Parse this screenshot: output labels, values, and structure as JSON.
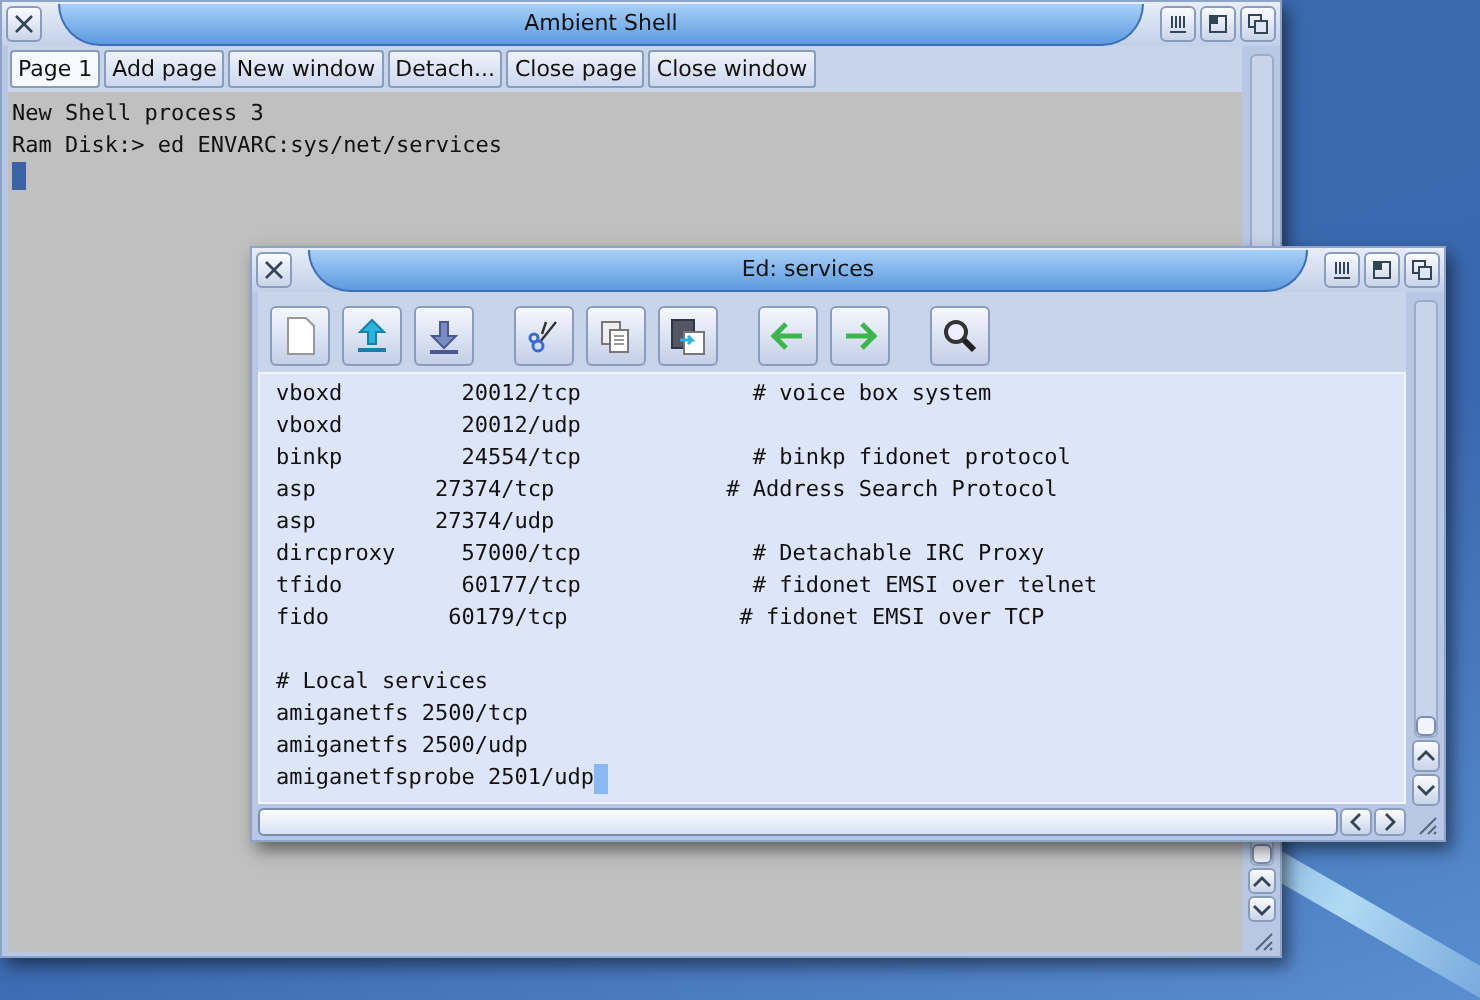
{
  "shell": {
    "title": "Ambient Shell",
    "page_tabs": [
      {
        "label": "Page 1",
        "selected": true
      }
    ],
    "buttons": [
      "Add page",
      "New window",
      "Detach...",
      "Close page",
      "Close window"
    ],
    "lines": [
      "New Shell process 3",
      "Ram Disk:> ed ENVARC:sys/net/services"
    ]
  },
  "editor": {
    "title": "Ed: services",
    "sections": [
      {
        "lines": [
          "vboxd         20012/tcp             # voice box system",
          "vboxd         20012/udp",
          "binkp         24554/tcp             # binkp fidonet protocol",
          "asp         27374/tcp             # Address Search Protocol",
          "asp         27374/udp",
          "dircproxy     57000/tcp             # Detachable IRC Proxy",
          "tfido         60177/tcp             # fidonet EMSI over telnet",
          "fido         60179/tcp             # fidonet EMSI over TCP"
        ]
      },
      {
        "lines": [
          "# Local services",
          "amiganetfs 2500/tcp",
          "amiganetfs 2500/udp",
          "amiganetfsprobe 2501/udp"
        ]
      }
    ]
  }
}
